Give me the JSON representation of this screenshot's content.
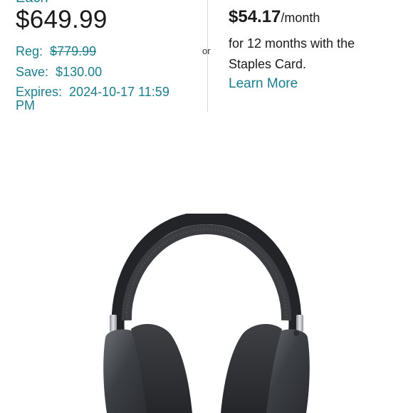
{
  "pricing": {
    "each_label": "Each",
    "price": "$649.99",
    "reg_label": "Reg:",
    "reg_value": "$779.99",
    "save_label": "Save:",
    "save_value": "$130.00",
    "expires_label": "Expires:",
    "expires_value": "2024-10-17 11:59 PM"
  },
  "divider_label": "or",
  "financing": {
    "amount": "$54.17",
    "per": "/month",
    "terms": "for 12 months with the Staples Card.",
    "learn_more": "Learn More"
  },
  "product_image": {
    "icon": "headphones-image"
  },
  "colors": {
    "accent": "#1b7d8c",
    "text": "#1a1a1a",
    "divider": "#d9d9d9"
  }
}
